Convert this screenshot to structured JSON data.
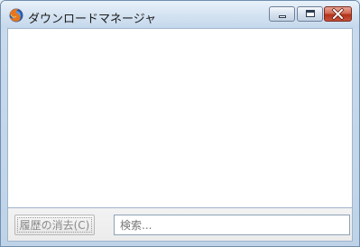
{
  "window": {
    "title": "ダウンロードマネージャ"
  },
  "controls": {
    "minimize_icon": "minimize-icon",
    "maximize_icon": "maximize-icon",
    "close_icon": "close-icon"
  },
  "footer": {
    "clear_history_label": "履歴の消去(C)",
    "search_placeholder": "検索..."
  },
  "colors": {
    "titlebar": "#d3e2f1",
    "list_background": "#ffffff",
    "close_button": "#c8503a"
  }
}
